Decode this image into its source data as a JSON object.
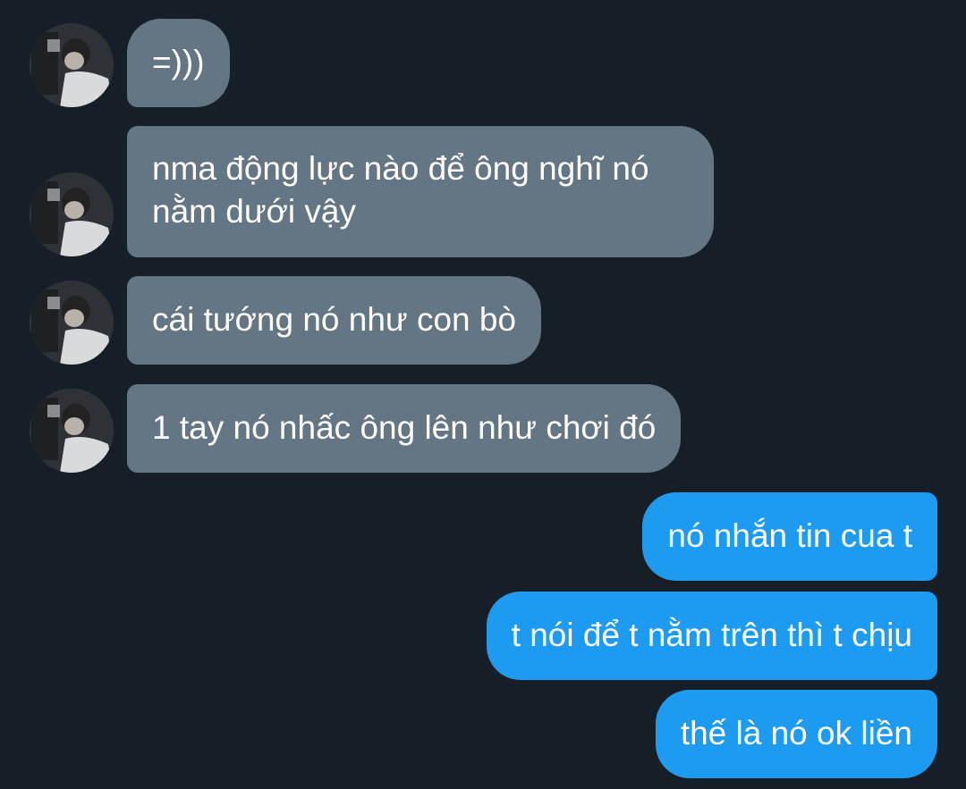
{
  "conversation": {
    "incoming": [
      {
        "text": "=)))"
      },
      {
        "text": "nma động lực nào để ông nghĩ nó\nnằm dưới vậy"
      },
      {
        "text": "cái tướng nó như con bò"
      },
      {
        "text": "1 tay nó nhấc ông lên như chơi đó"
      }
    ],
    "outgoing": [
      {
        "text": "nó nhắn tin cua t"
      },
      {
        "text": "t nói để t nằm trên thì t chịu"
      },
      {
        "text": "thế là nó ok liền"
      }
    ]
  },
  "colors": {
    "background": "#161f28",
    "incoming_bubble": "#647584",
    "outgoing_bubble": "#1d9bf0",
    "text": "#ffffff"
  }
}
